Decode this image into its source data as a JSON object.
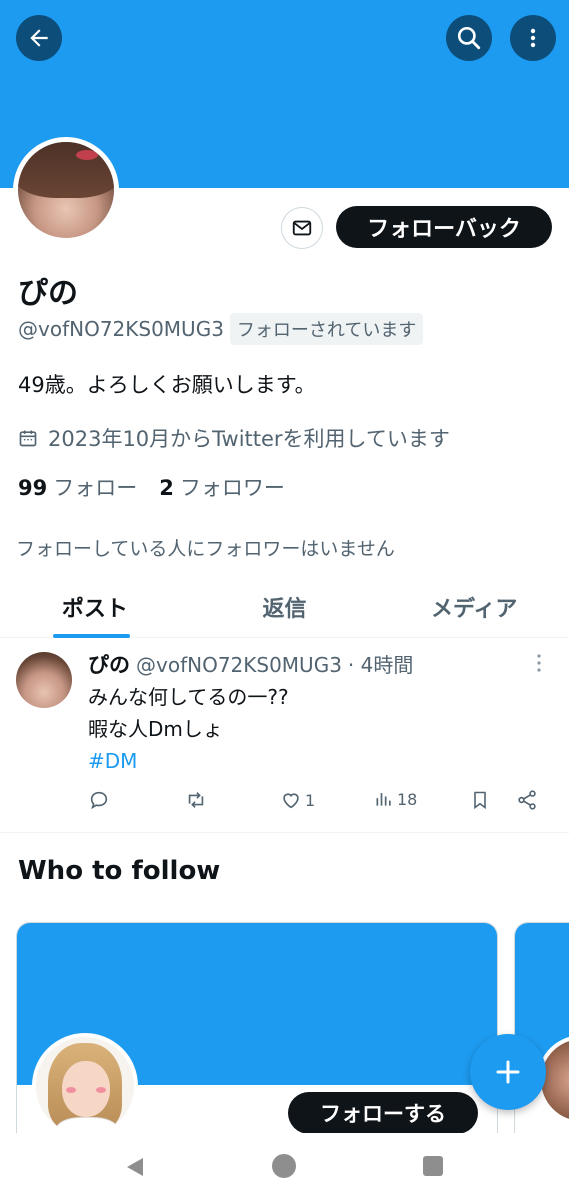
{
  "header": {
    "back_icon": "arrow-left-icon",
    "search_icon": "search-icon",
    "more_icon": "vertical-dots-icon",
    "banner_color": "#1d9bf0"
  },
  "profile": {
    "name": "ぴの",
    "handle": "@vofNO72KS0MUG3",
    "follows_you": "フォローされています",
    "bio": "49歳。よろしくお願いします。",
    "joined": "2023年10月からTwitterを利用しています",
    "following_count": "99",
    "following_label": "フォロー",
    "followers_count": "2",
    "followers_label": "フォロワー",
    "no_mutual": "フォローしている人にフォロワーはいません",
    "follow_back_label": "フォローバック"
  },
  "tabs": [
    {
      "label": "ポスト",
      "active": true
    },
    {
      "label": "返信",
      "active": false
    },
    {
      "label": "メディア",
      "active": false
    }
  ],
  "tweet": {
    "name": "ぴの",
    "handle": "@vofNO72KS0MUG3",
    "time": "· 4時間",
    "line1": "みんな何してるの一??",
    "line2": "暇な人Dmしょ",
    "hashtag": "#DM",
    "likes": "1",
    "views": "18"
  },
  "who_to_follow": {
    "title": "Who to follow",
    "follow_label": "フォローする"
  },
  "colors": {
    "accent": "#1d9bf0",
    "text": "#0f1419",
    "secondary": "#536471"
  }
}
